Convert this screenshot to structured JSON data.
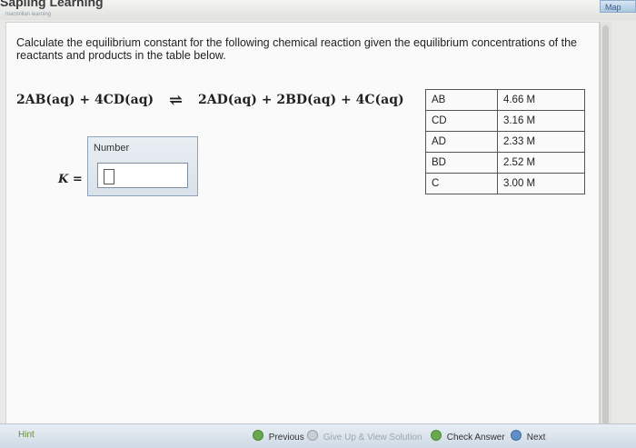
{
  "header": {
    "brand": "Sapling Learning",
    "brand_sub": "macmillan learning",
    "map_button": "Map"
  },
  "question": {
    "text": "Calculate the equilibrium constant for the following chemical reaction given the equilibrium concentrations of the reactants and products in the table below."
  },
  "equation": {
    "left": "2AB(aq) + 4CD(aq)",
    "arrow": "⇌",
    "right": "2AD(aq) + 2BD(aq) + 4C(aq)"
  },
  "concentrations": [
    {
      "species": "AB",
      "value": "4.66 M"
    },
    {
      "species": "CD",
      "value": "3.16 M"
    },
    {
      "species": "AD",
      "value": "2.33 M"
    },
    {
      "species": "BD",
      "value": "2.52 M"
    },
    {
      "species": "C",
      "value": "3.00 M"
    }
  ],
  "answer": {
    "number_label": "Number",
    "k_label": "K ="
  },
  "footer": {
    "hint": "Hint",
    "previous": "Previous",
    "give_up": "Give Up & View Solution",
    "check": "Check Answer",
    "next": "Next"
  }
}
